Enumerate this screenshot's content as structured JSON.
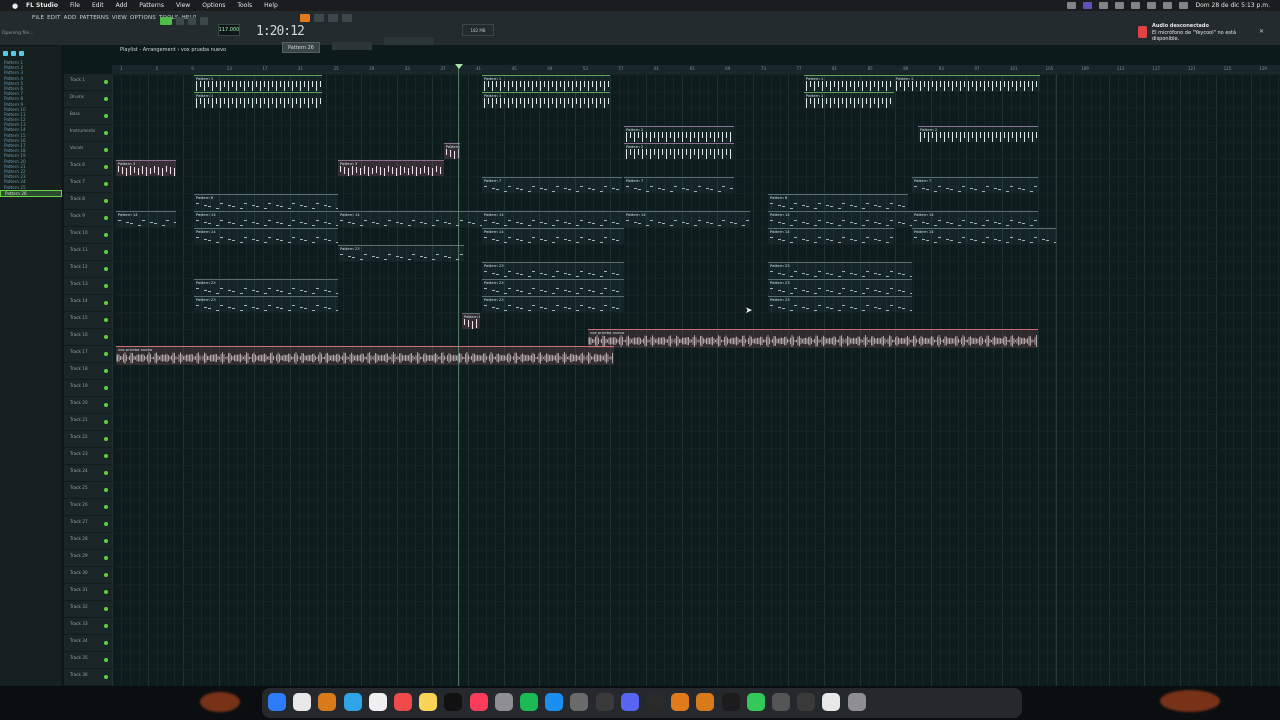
{
  "menubar": {
    "apple": "",
    "app": "FL Studio",
    "items": [
      "File",
      "Edit",
      "Add",
      "Patterns",
      "View",
      "Options",
      "Tools",
      "Help"
    ],
    "clock": "Dom 28 de dic  5:13 p.m."
  },
  "fl": {
    "menus": [
      "FILE",
      "EDIT",
      "ADD",
      "PATTERNS",
      "VIEW",
      "OPTIONS",
      "TOOLS",
      "HELP"
    ],
    "hint": "Opening file...",
    "song_time": "1:20:12",
    "tempo": "117.000",
    "pattern_selector": "Pattern 26",
    "cpu": "182 MB",
    "playlist_title": "Playlist - Arrangement › vox prueba nuevo"
  },
  "notification": {
    "title": "Audio desconectado",
    "body": "El micrófono de \"Yeycool\" no está disponible."
  },
  "browser": {
    "patterns": [
      "Pattern 1",
      "Pattern 2",
      "Pattern 3",
      "Pattern 4",
      "Pattern 5",
      "Pattern 6",
      "Pattern 7",
      "Pattern 8",
      "Pattern 9",
      "Pattern 10",
      "Pattern 11",
      "Pattern 12",
      "Pattern 13",
      "Pattern 14",
      "Pattern 15",
      "Pattern 16",
      "Pattern 17",
      "Pattern 18",
      "Pattern 19",
      "Pattern 20",
      "Pattern 21",
      "Pattern 22",
      "Pattern 23",
      "Pattern 24",
      "Pattern 25",
      "Pattern 26"
    ],
    "selected_index": 25
  },
  "tracks": [
    "Track 1",
    "Drums",
    "Bass",
    "Instruments",
    "Vocals",
    "Track 6",
    "Track 7",
    "Track 8",
    "Track 9",
    "Track 10",
    "Track 11",
    "Track 12",
    "Track 13",
    "Track 14",
    "Track 15",
    "Track 16",
    "Track 17",
    "Track 18",
    "Track 19",
    "Track 20",
    "Track 21",
    "Track 22",
    "Track 23",
    "Track 24",
    "Track 25",
    "Track 26",
    "Track 27",
    "Track 28",
    "Track 29",
    "Track 30",
    "Track 31",
    "Track 32",
    "Track 33",
    "Track 34",
    "Track 35",
    "Track 36"
  ],
  "ruler_ticks": [
    "1",
    "5",
    "9",
    "13",
    "17",
    "21",
    "25",
    "29",
    "33",
    "37",
    "41",
    "45",
    "49",
    "53",
    "57",
    "61",
    "65",
    "69",
    "73",
    "77",
    "81",
    "85",
    "89",
    "93",
    "97",
    "101",
    "105",
    "109",
    "113",
    "117",
    "121",
    "125",
    "129",
    "133"
  ],
  "clips": [
    {
      "label": "Pattern 1",
      "color": "#62a35c"
    },
    {
      "label": "Pattern 2",
      "color": "#8a6f8f"
    },
    {
      "label": "Pattern 3",
      "color": "#8a6f8f"
    },
    {
      "label": "Pattern 7",
      "color": "#5c6d70"
    },
    {
      "label": "Pattern 8",
      "color": "#5c6d70"
    },
    {
      "label": "Pattern 14",
      "color": "#5c6d70"
    },
    {
      "label": "Pattern 23",
      "color": "#5c6d70"
    },
    {
      "label": "vox prueba nuevo",
      "color": "#c96f76"
    },
    {
      "label": "vox prueba nuevo",
      "color": "#c96f76"
    }
  ]
}
